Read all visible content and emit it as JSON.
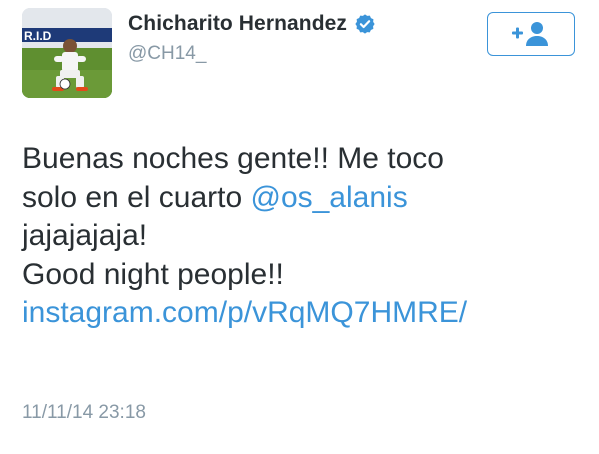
{
  "author": {
    "display_name": "Chicharito Hernandez",
    "handle": "@CH14_",
    "verified": true,
    "avatar_icon": "profile-photo"
  },
  "follow_button": {
    "icon": "follow-user-icon",
    "color": "#3b94d9"
  },
  "tweet": {
    "line1": "Buenas noches gente!! Me toco",
    "line2_prefix": "solo en el cuarto ",
    "mention": "@os_alanis",
    "line3": "jajajajaja!",
    "line4": "Good night people!!",
    "link": "instagram.com/p/vRqMQ7HMRE/",
    "timestamp": "11/11/14 23:18"
  },
  "colors": {
    "link": "#3b94d9",
    "meta": "#8899a6",
    "text": "#292f33"
  }
}
